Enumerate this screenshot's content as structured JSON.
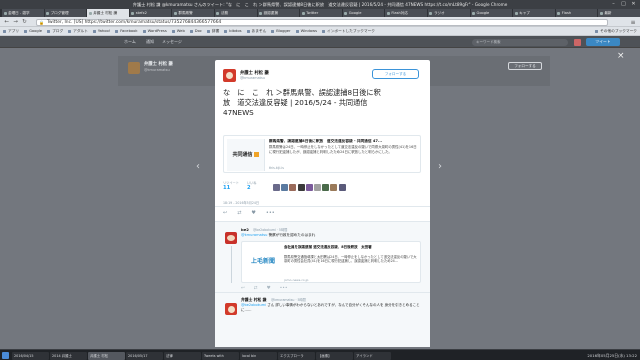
{
  "window": {
    "title": "弁護士 村松 謙 @kmuramatsu さんのツイート: \"な　に　こ　れ ＞群馬県警、誤認逮捕8日後に釈放　道交法違反容疑 | 2016/5/24 - 共同通信 47NEWS https://t.co/mLt89gFr\" - Google Chrome",
    "controls": [
      "–",
      "□",
      "✕"
    ]
  },
  "tabs": [
    {
      "label": "金曜日 - 雑学",
      "active": false
    },
    {
      "label": "ブログ管理",
      "active": false
    },
    {
      "label": "弁護士 村松 謙",
      "active": true
    },
    {
      "label": "stefx2",
      "active": false
    },
    {
      "label": "群馬県警",
      "active": false
    },
    {
      "label": "法務",
      "active": false
    },
    {
      "label": "誤認逮捕",
      "active": false
    },
    {
      "label": "Twitter",
      "active": false
    },
    {
      "label": "Google",
      "active": false
    },
    {
      "label": "Flash対応",
      "active": false
    },
    {
      "label": "ラジオ",
      "active": false
    },
    {
      "label": "Google",
      "active": false
    },
    {
      "label": "キャプ",
      "active": false
    },
    {
      "label": "Flash",
      "active": false
    },
    {
      "label": "最新",
      "active": false
    }
  ],
  "address": {
    "url": "https://twitter.com/kmuramatsu/status/735276844366577664",
    "lock_label": "Twitter, Inc. [US]"
  },
  "bookmarks": [
    "アプリ",
    "Google",
    "ブログ",
    "アダルト",
    "Yahoo!",
    "Facebook",
    "WordPress",
    "Web",
    "Doc",
    "辞書",
    "bibdos",
    "あまぞん",
    "Blogger",
    "Windows",
    "インポートしたブックマーク"
  ],
  "bookmarks_other": "その他のブックマーク",
  "twitter_nav": {
    "home": "ホーム",
    "notifications": "通知",
    "messages": "メッセージ",
    "search_placeholder": "キーワード検索",
    "tweet_button": "ツイート"
  },
  "bg_profile": {
    "name": "弁護士 村松 謙",
    "handle": "@kmuramatsu",
    "follow": "フォローする"
  },
  "tweet": {
    "name": "弁護士 村松 謙",
    "handle": "@kmuramatsu",
    "follow": "フォローする",
    "text_line1": "な　に　こ　れ ＞群馬県警、誤認逮捕8日後に釈",
    "text_line2": "放　道交法違反容疑 | 2016/5/24 - 共同通信",
    "text_line3": "47NEWS",
    "card": {
      "logo": "共同通信",
      "title": "群馬県警、誤認逮捕8日後に釈放　道交法違反容疑 - 共同通信 47...",
      "description": "群馬県警は24日、一時停止をしなかったとして道交法違反の疑いで同県大泉町の男性(41)を16日に現行犯逮捕したが、誤認逮捕と判明したため24日に釈放したと明らかにした。",
      "domain": "this.kiji.is"
    },
    "retweets_label": "リツイート",
    "retweets": "11",
    "likes_label": "いいね",
    "likes": "2",
    "timestamp": "18:19 - 2016年5月24日",
    "actions": [
      "↩",
      "⇄",
      "♥",
      "•••"
    ]
  },
  "face_colors": [
    "#6a6a8a",
    "#5a7aa0",
    "#9a6a5a",
    "#3a3a3a",
    "#7a5a9a",
    "#a0a0a0",
    "#4a6a4a",
    "#9a7a5a",
    "#5a5a7a"
  ],
  "replies": [
    {
      "name": "be2",
      "handle": "@be2obokumi",
      "time": "· 5時間",
      "reply_to": "@kmuramatsu",
      "text": "警察が行政を認めたのはまれ",
      "card": {
        "logo": "上毛新聞",
        "title": "会社員を誤認逮捕 道交法違反容疑、8日後釈放　太田署",
        "description": "群馬県警交通指導課と太田署は24日、一時停止をしなかったとして道交法違反の疑いで大泉町の男性会社員(41)を16日に現行犯逮捕し、誤認逮捕と判明したため24...",
        "domain": "jomo-news.co.jp"
      }
    },
    {
      "name": "弁護士 村松 謙",
      "handle": "@kmuramatsu",
      "time": "· 5時間",
      "reply_to": "@be2obokumi",
      "text": "さん 詳しい事情がわからないとあれですが、なんで自分がくそんなの人を 身分を引きとめることに……"
    }
  ],
  "taskbar": {
    "items": [
      "2016/04/15",
      "2014 弁護士",
      "弁護士 村松",
      "2016/05/17",
      "法律",
      "Tweets with",
      "local bin",
      "エクスプローラ",
      "【画像】",
      "アイランド"
    ],
    "clock": "2016年05月25日(水) 13:22"
  }
}
